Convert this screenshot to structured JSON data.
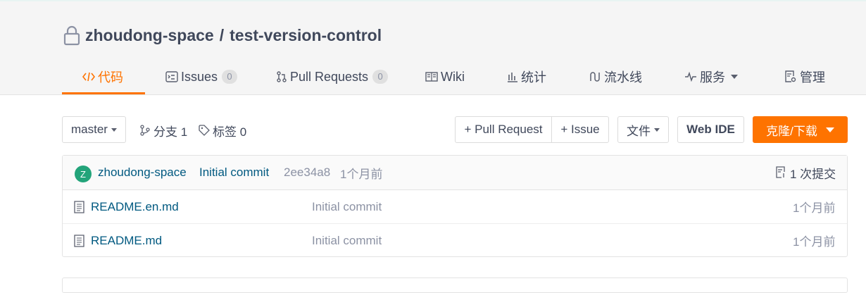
{
  "repo": {
    "owner": "zhoudong-space",
    "separator": "/",
    "name": "test-version-control"
  },
  "tabs": [
    {
      "label": "代码",
      "icon": "code-icon",
      "active": true
    },
    {
      "label": "Issues",
      "icon": "issues-icon",
      "count": "0"
    },
    {
      "label": "Pull Requests",
      "icon": "pull-request-icon",
      "count": "0"
    },
    {
      "label": "Wiki",
      "icon": "book-icon"
    },
    {
      "label": "统计",
      "icon": "bar-chart-icon"
    },
    {
      "label": "流水线",
      "icon": "pipeline-icon"
    },
    {
      "label": "服务",
      "icon": "pulse-icon",
      "dropdown": true
    },
    {
      "label": "管理",
      "icon": "settings-doc-icon"
    }
  ],
  "toolbar": {
    "branch": "master",
    "branches": "分支 1",
    "tags": "标签 0",
    "new_pr": "+ Pull Request",
    "new_issue": "+ Issue",
    "file_menu": "文件",
    "web_ide": "Web IDE",
    "clone": "克隆/下载"
  },
  "latest_commit": {
    "avatar_letter": "Z",
    "author": "zhoudong-space",
    "message": "Initial commit",
    "sha": "2ee34a8",
    "time": "1个月前",
    "commits_count": "1 次提交"
  },
  "files": [
    {
      "name": "README.en.md",
      "message": "Initial commit",
      "time": "1个月前"
    },
    {
      "name": "README.md",
      "message": "Initial commit",
      "time": "1个月前"
    }
  ],
  "colors": {
    "accent": "#fe7300",
    "link": "#005980",
    "avatar": "#23a47a",
    "text": "#40485b",
    "muted": "#8c92a4"
  }
}
